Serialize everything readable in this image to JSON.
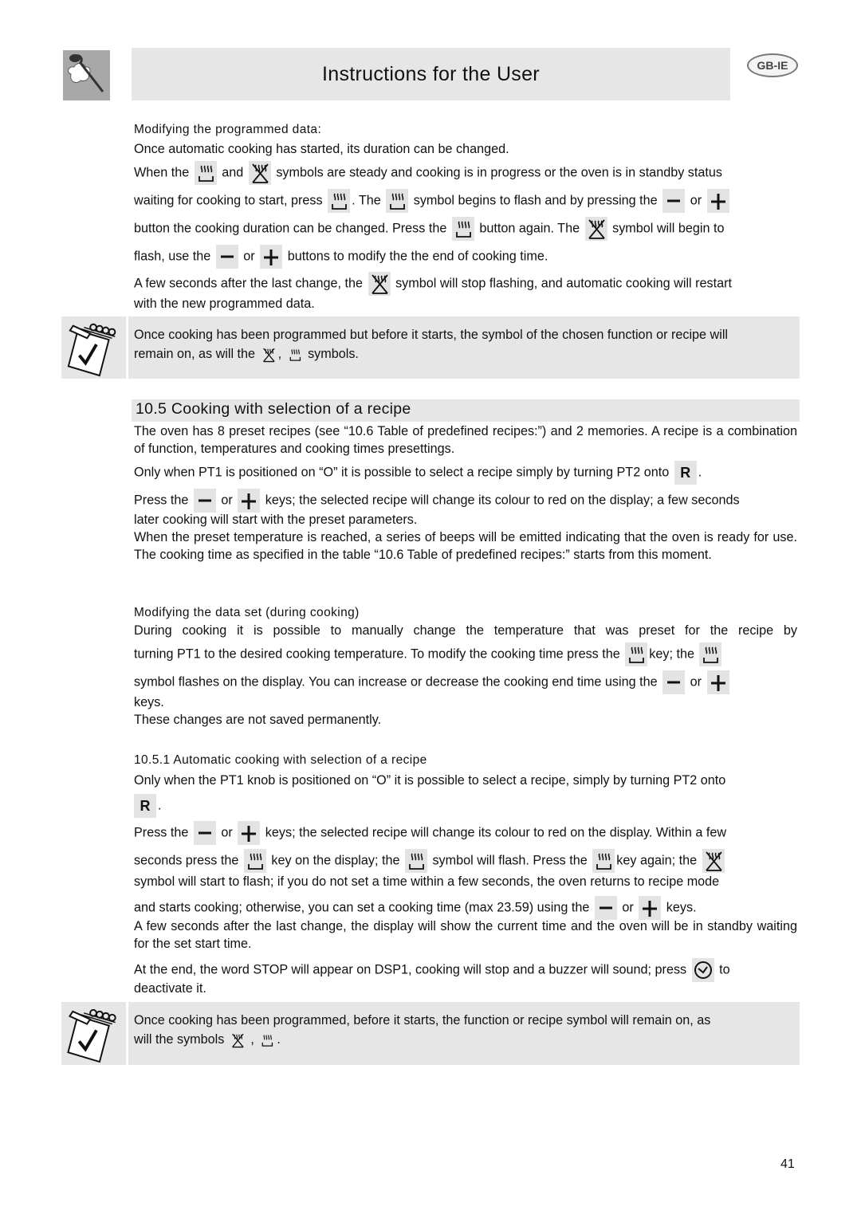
{
  "header": {
    "title": "Instructions for the User",
    "region_badge": "GB-IE",
    "logo_icon": "chef-spoon-icon"
  },
  "block1": {
    "subheading": "Modifying the programmed data:",
    "l1": "Once automatic cooking has started, its duration can be changed.",
    "l2a": "When the",
    "l2b": "and",
    "l2c": "symbols are steady and cooking is in progress or the oven is in standby status",
    "l3a": "waiting for cooking to start, press",
    "l3b": ". The",
    "l3c": "symbol begins to flash and by pressing the",
    "l3d": "or",
    "l4a": "button the cooking duration can be changed. Press the",
    "l4b": "button again. The",
    "l4c": "symbol will begin to",
    "l5a": "flash, use the",
    "l5b": "or",
    "l5c": "buttons to modify the the end of cooking time.",
    "l6a": "A few seconds after the last change, the",
    "l6b": "symbol will stop flashing, and automatic cooking will restart",
    "l7": "with the new programmed data."
  },
  "note1": {
    "l1": "Once cooking has been programmed but before it starts, the symbol of the chosen function or recipe will",
    "l2a": "remain on, as will the",
    "l2b": ",",
    "l2c": "symbols."
  },
  "section": {
    "title": "10.5 Cooking with selection of a recipe",
    "p1": "The oven has 8 preset recipes (see “10.6 Table of predefined recipes:”) and 2 memories. A recipe is a combination of function, temperatures and cooking times presettings.",
    "p2a": "Only when PT1 is positioned on “O” it is possible to select a recipe simply by turning PT2 onto",
    "p2b": ".",
    "recipe_key": "R",
    "p3a": "Press the",
    "p3b": "or",
    "p3c": "keys; the selected recipe will change its colour to red on the display; a few seconds",
    "p3d": "later cooking will start with the preset parameters.",
    "p4": "When the preset temperature is reached, a series of beeps will be emitted indicating that the oven is ready for use. The cooking time as specified in the table “10.6 Table of predefined recipes:” starts from this moment.",
    "sub2": "Modifying the data set (during cooking)",
    "p5": "During cooking it is possible to manually change the temperature that was preset for the recipe by",
    "p6a": "turning PT1 to the desired cooking temperature. To modify the cooking time press the",
    "p6b": "key; the",
    "p7a": "symbol flashes on the display. You can increase or decrease the cooking end time using the",
    "p7b": "or",
    "p8": "keys.",
    "p9": "These changes are not saved permanently.",
    "sub3": "10.5.1 Automatic cooking with selection of a recipe",
    "p10": "Only when the PT1 knob is positioned on “O” it is possible to select a recipe, simply by turning PT2 onto",
    "p11": ".",
    "p12a": "Press the",
    "p12b": "or",
    "p12c": "keys; the selected recipe will change its colour to red on the display. Within a few",
    "p13a": "seconds press the",
    "p13b": "key on the display; the",
    "p13c": "symbol will flash. Press the",
    "p13d": "key again; the",
    "p14": "symbol will start to flash; if you do not set a time within a few seconds, the oven returns to recipe mode",
    "p15a": "and starts cooking; otherwise, you can set a cooking time (max 23.59) using the",
    "p15b": "or",
    "p15c": "keys.",
    "p16": "A few seconds after the last change, the display will show the current time and the oven will be in standby waiting for the set start time.",
    "p17a": "At the end, the word STOP will appear on DSP1, cooking will stop and a buzzer will sound; press",
    "p17b": "to",
    "p18": "deactivate it."
  },
  "note2": {
    "l1": "Once cooking has been programmed, before it starts, the function or recipe symbol will remain on, as",
    "l2a": "will the symbols",
    "l2b": ",",
    "l2c": "."
  },
  "footer": {
    "page_number": "41"
  }
}
